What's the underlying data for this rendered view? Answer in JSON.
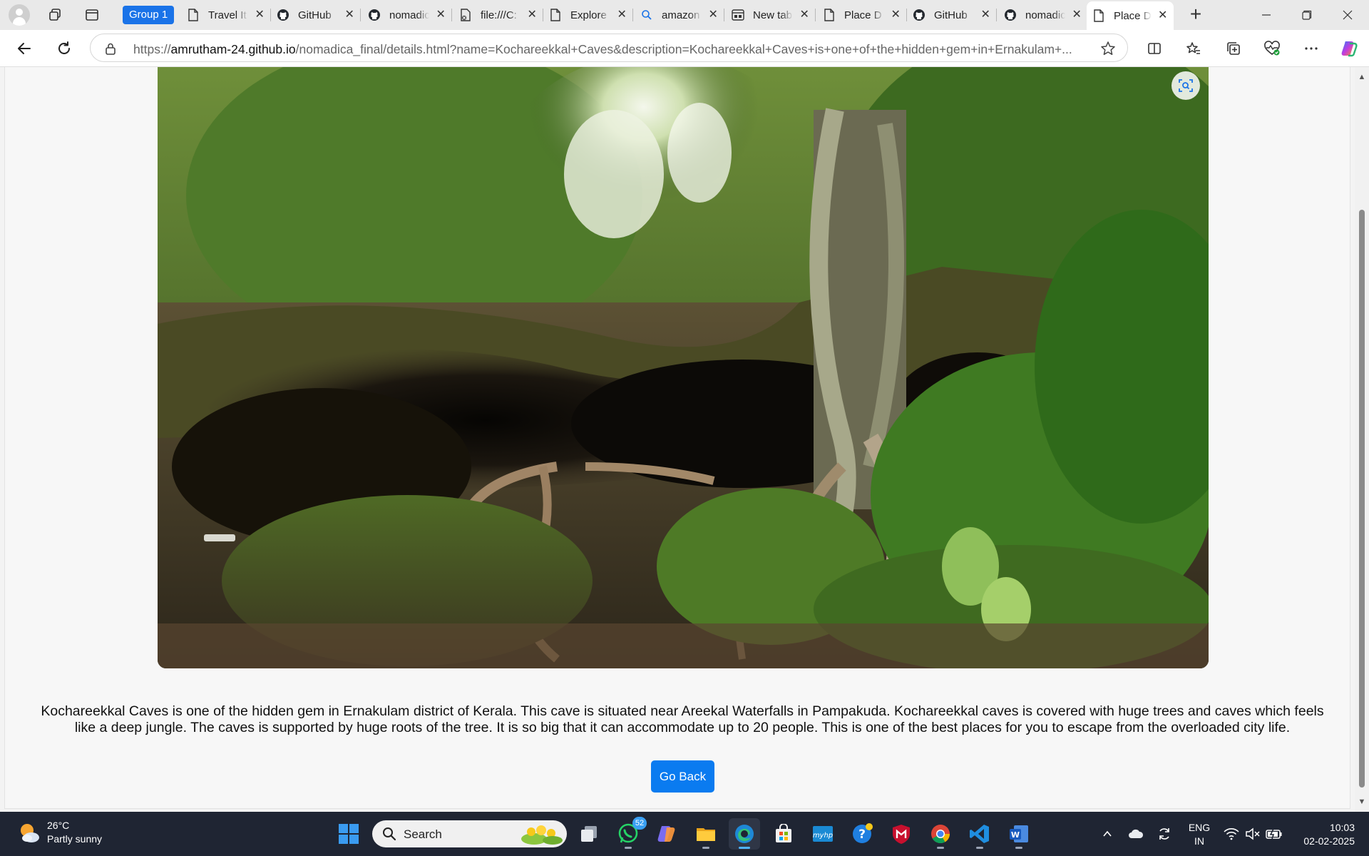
{
  "browser": {
    "group_label": "Group 1",
    "tabs": [
      {
        "title": "Travel It",
        "icon": "page-icon"
      },
      {
        "title": "GitHub",
        "icon": "github-icon"
      },
      {
        "title": "nomadica",
        "icon": "github-icon"
      },
      {
        "title": "file:///C:",
        "icon": "file-icon"
      },
      {
        "title": "Explore",
        "icon": "page-icon"
      },
      {
        "title": "amazon",
        "icon": "search-icon"
      },
      {
        "title": "New tab",
        "icon": "newtab-icon"
      },
      {
        "title": "Place D",
        "icon": "page-icon"
      },
      {
        "title": "GitHub",
        "icon": "github-icon"
      },
      {
        "title": "nomadica",
        "icon": "github-icon"
      },
      {
        "title": "Place D",
        "icon": "page-icon",
        "active": true
      }
    ],
    "address": {
      "scheme": "https://",
      "host": "amrutham-24.github.io",
      "path": "/nomadica_final/details.html?name=Kochareekkal+Caves&description=Kochareekkal+Caves+is+one+of+the+hidden+gem+in+Ernakulam+..."
    }
  },
  "page": {
    "photo_alt": "Kochareekkal Caves",
    "description": "Kochareekkal Caves is one of the hidden gem in Ernakulam district of Kerala. This cave is situated near Areekal Waterfalls in Pampakuda. Kochareekkal caves is covered with huge trees and caves which feels like a deep jungle. The caves is supported by huge roots of the tree. It is so big that it can accommodate up to 20 people. This is one of the best places for you to escape from the overloaded city life.",
    "go_back_label": "Go Back",
    "button_color": "#0a7bf0"
  },
  "taskbar": {
    "weather": {
      "temp": "26°C",
      "condition": "Partly sunny"
    },
    "search_placeholder": "Search",
    "whatsapp_badge": "52",
    "language": {
      "line1": "ENG",
      "line2": "IN"
    },
    "clock": {
      "time": "10:03",
      "date": "02-02-2025"
    }
  }
}
